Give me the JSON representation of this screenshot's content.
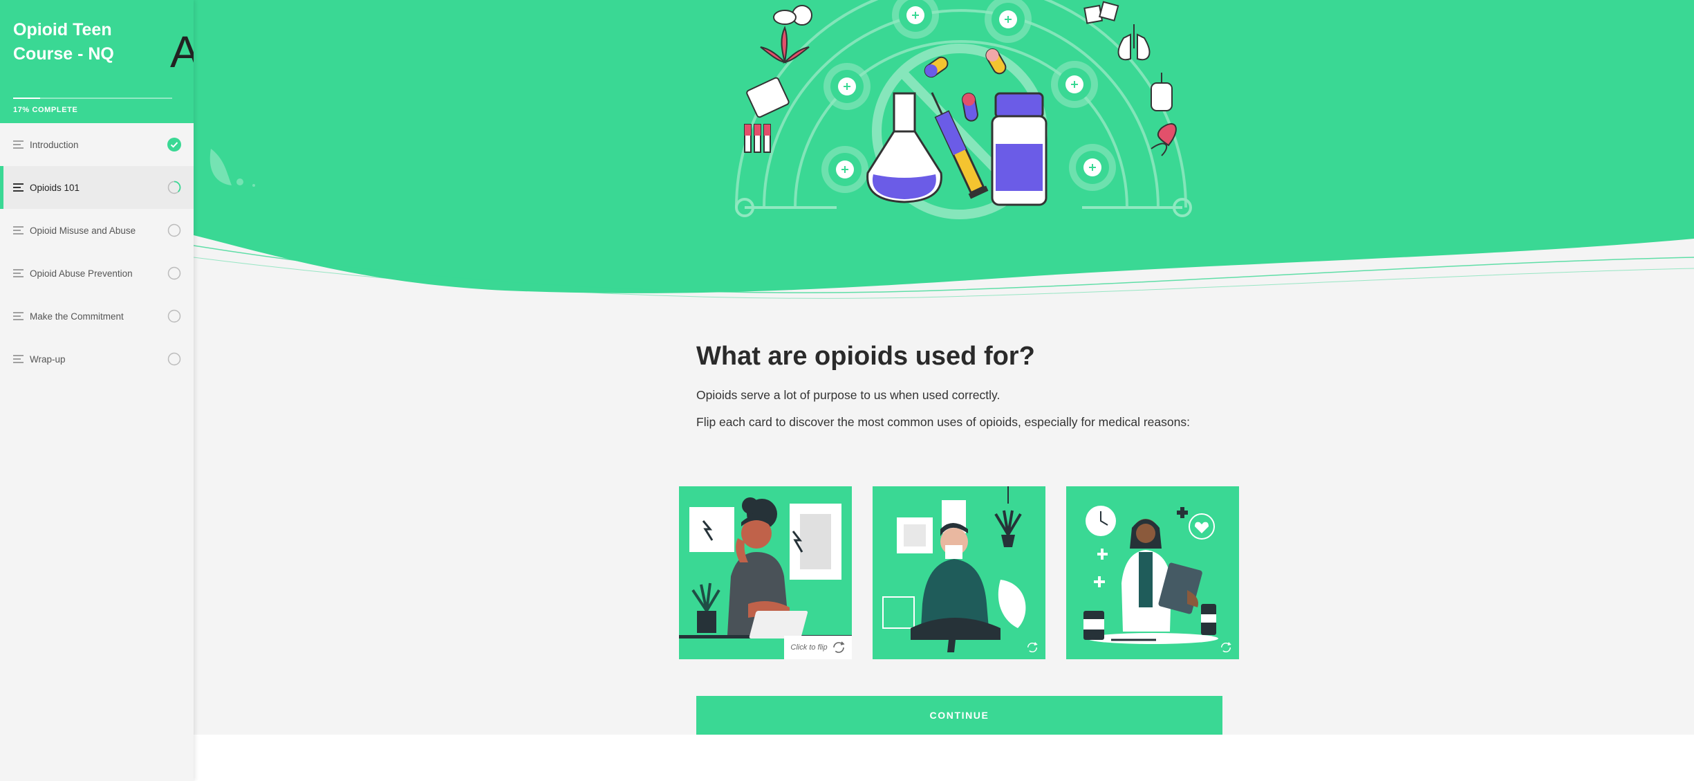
{
  "course": {
    "title": "Opioid Teen Course - NQ",
    "progress_percent": 17,
    "progress_label": "17% COMPLETE"
  },
  "sidebar": {
    "lessons": [
      {
        "label": "Introduction",
        "status": "complete"
      },
      {
        "label": "Opioids 101",
        "status": "in-progress"
      },
      {
        "label": "Opioid Misuse and Abuse",
        "status": "not-started"
      },
      {
        "label": "Opioid Abuse Prevention",
        "status": "not-started"
      },
      {
        "label": "Make the Commitment",
        "status": "not-started"
      },
      {
        "label": "Wrap-up",
        "status": "not-started"
      }
    ]
  },
  "main": {
    "heading": "What are opioids used for?",
    "paragraph_1": "Opioids serve a lot of purpose to us when used correctly.",
    "paragraph_2": "Flip each card to discover the most common uses of opioids, especially for medical reasons:",
    "cards": [
      {
        "illustration": "woman-headache-illustration",
        "flip_hint": "Click to flip"
      },
      {
        "illustration": "man-sneezing-illustration"
      },
      {
        "illustration": "doctor-clipboard-illustration"
      }
    ],
    "continue_label": "CONTINUE"
  },
  "colors": {
    "accent": "#3ad894",
    "background": "#f4f4f4",
    "text_dark": "#2a2a2a",
    "purple": "#6b5ce7"
  }
}
